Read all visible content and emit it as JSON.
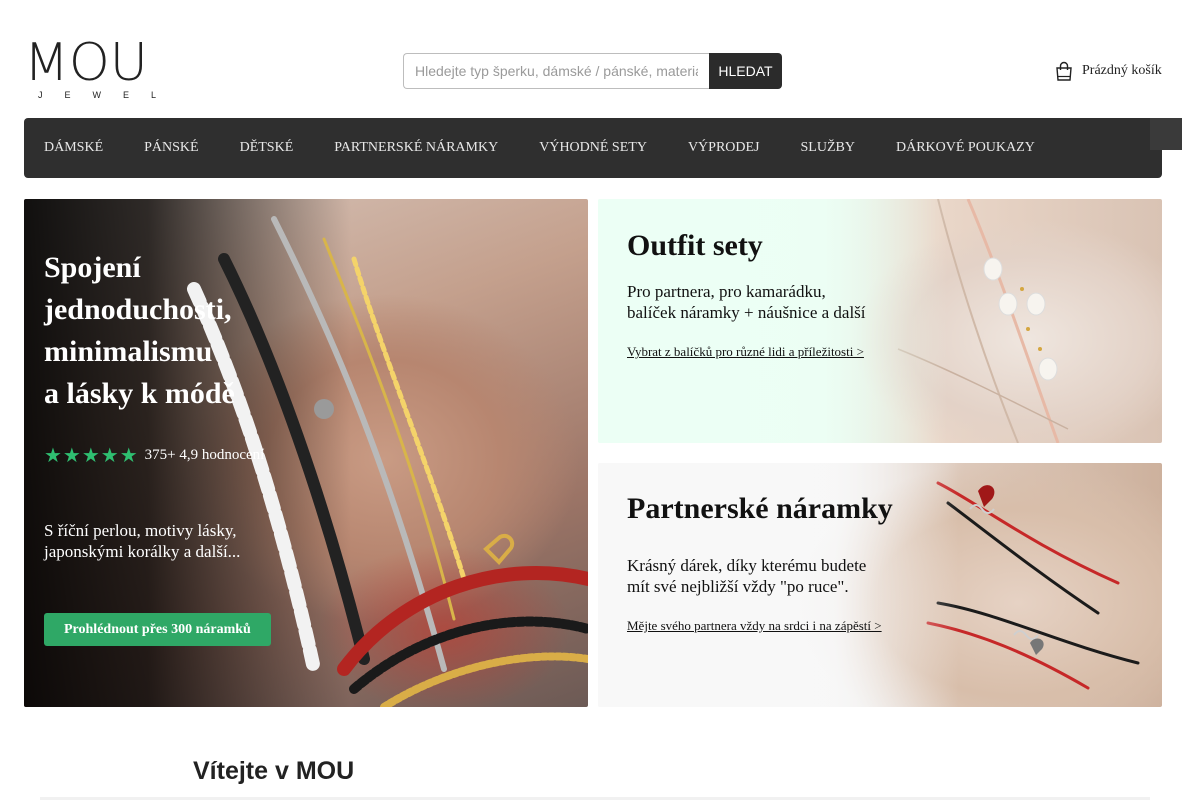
{
  "header": {
    "logo_text": "MOU",
    "logo_sub": "JEWEL",
    "search": {
      "placeholder": "Hledejte typ šperku, dámské / pánské, materiál...",
      "button_label": "HLEDAT"
    },
    "cart": {
      "icon": "shopping-bag-icon",
      "label": "Prázdný košík"
    }
  },
  "nav": {
    "items": [
      {
        "label": "Dámské"
      },
      {
        "label": "Pánské"
      },
      {
        "label": "Dětské"
      },
      {
        "label": "Partnerské náramky"
      },
      {
        "label": "Výhodné sety"
      },
      {
        "label": "Výprodej"
      },
      {
        "label": "Služby"
      },
      {
        "label": "Dárkové poukazy"
      }
    ],
    "side_button_icon": ""
  },
  "hero": {
    "title_lines": [
      "Spojení",
      "jednoduchosti,",
      "minimalismu",
      "a lásky k módě"
    ],
    "stars": "★★★★★",
    "rating_text": "375+ 4,9 hodnocení",
    "desc_lines": [
      "S říční perlou, motivy lásky,",
      "japonskými korálky a další..."
    ],
    "cta_label": "Prohlédnout přes 300 náramků",
    "accent_color": "#2fa866",
    "star_color": "#2fbf71"
  },
  "promos": {
    "outfit": {
      "title": "Outfit sety",
      "desc_lines": [
        "Pro partnera, pro kamarádku,",
        "balíček náramky + náušnice a další"
      ],
      "link": "Vybrat z balíčků pro různé lidi a příležitosti >"
    },
    "partner": {
      "title": "Partnerské náramky",
      "desc_lines": [
        "Krásný dárek, díky kterému budete",
        "mít své nejbližší vždy \"po ruce\"."
      ],
      "link": "Mějte svého partnera vždy na srdci i na zápěstí >"
    }
  },
  "welcome": {
    "heading": "Vítejte v MOU"
  }
}
